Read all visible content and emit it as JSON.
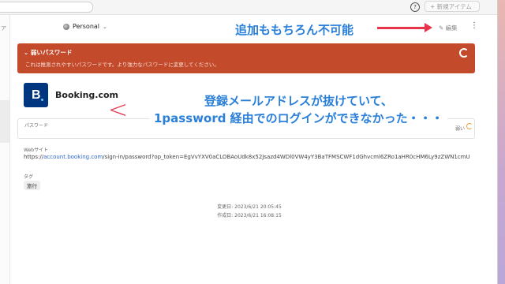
{
  "toolbar": {
    "help_icon": "?",
    "new_item_label": "+ 新規アイテム"
  },
  "left_strip_label": "ア",
  "vault": {
    "name": "Personal",
    "icon": "vault-icon",
    "chevron": "⌄"
  },
  "header_actions": {
    "edit_label": "✎ 編集",
    "more_icon": "⋮"
  },
  "annotations": {
    "top": "追加ももちろん不可能",
    "line1": "登録メールアドレスが抜けていて、",
    "line2": "1password 経由でのログインができなかった・・・",
    "bracket": "<"
  },
  "weak_banner": {
    "title": "⌄  弱いパスワード",
    "description": "これは推測されやすいパスワードです。より強力なパスワードに変更してください。"
  },
  "item": {
    "logo_letter": "B",
    "title": "Booking.com"
  },
  "password_field": {
    "label": "パスワード",
    "strength": "弱い"
  },
  "website": {
    "label": "Webサイト",
    "prefix": "https://",
    "domain": "account.booking.com",
    "rest": "/sign-in/password?op_token=EgVvYXV0aCLOBAoUdk8x52Jsazd4WDl0VW4yY3BaTFMSCWF1dGhvcml6ZRo1aHR0cHM6Ly9zZWN1cmU..."
  },
  "tags": {
    "label": "タグ",
    "items": [
      "旅行"
    ]
  },
  "meta": {
    "modified": "変更日: 2023/6/21 20:05:45",
    "created": "作成日: 2023/6/21 16:08:15"
  },
  "colors": {
    "annotation_blue": "#2a7fd8",
    "arrow_red": "#e8334a",
    "banner": "#c34a2b",
    "logo": "#003580"
  }
}
